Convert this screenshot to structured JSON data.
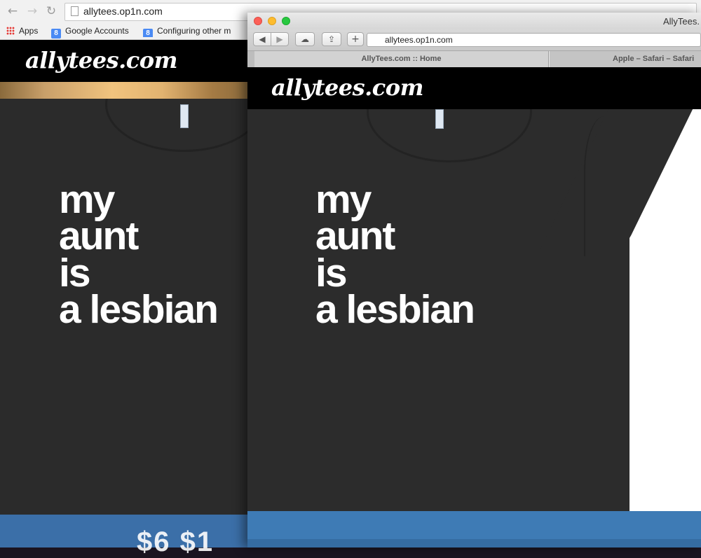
{
  "chrome": {
    "url": "allytees.op1n.com",
    "back_icon": "arrow-left-icon",
    "forward_icon": "arrow-right-icon",
    "reload_icon": "reload-icon",
    "bookmarks": [
      {
        "label": "Apps",
        "icon": "apps-grid-icon"
      },
      {
        "label": "Google Accounts",
        "icon": "google-icon"
      },
      {
        "label": "Configuring other m",
        "icon": "google-icon"
      }
    ]
  },
  "back_page": {
    "logo": "allytees.com",
    "shirt_text": [
      "my",
      "aunt",
      "is",
      "a lesbian"
    ],
    "price_fragment": "$6 $1"
  },
  "safari": {
    "window_title": "AllyTees.",
    "url": "allytees.op1n.com",
    "tabs": [
      {
        "label": "AllyTees.com :: Home",
        "active": true
      },
      {
        "label": "Apple – Safari – Safari",
        "active": false
      }
    ]
  },
  "front_page": {
    "logo": "allytees.com",
    "shirt_text": [
      "my",
      "aunt",
      "is",
      "a lesbian"
    ]
  },
  "colors": {
    "header": "#000000",
    "shirt": "#2c2c2c",
    "gold_band": "#f1c37e",
    "footer_blue": "#3e7bb5"
  }
}
